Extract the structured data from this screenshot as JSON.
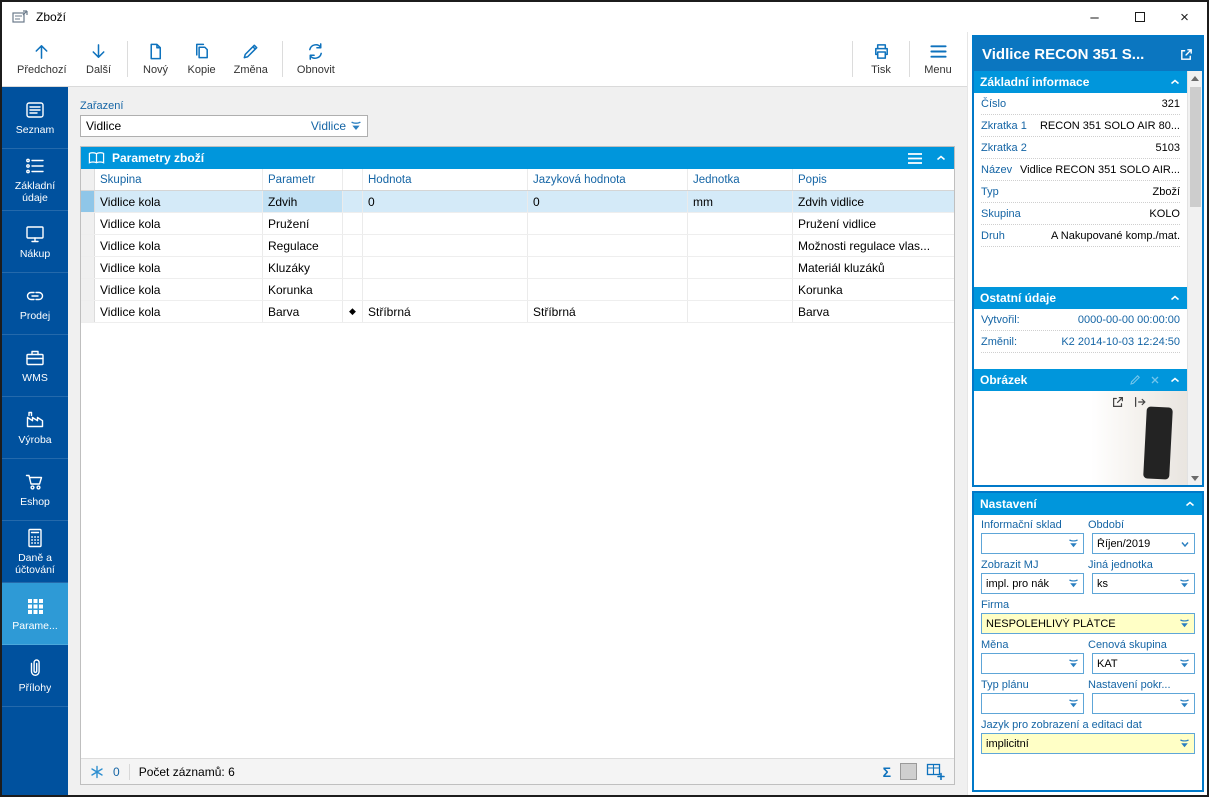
{
  "window": {
    "title": "Zboží",
    "controls": {
      "minimize": "–",
      "close": "×"
    }
  },
  "colors": {
    "accent": "#0096dc",
    "sidebar": "#00519e",
    "sidebar_active": "#2e9ad6",
    "panel_border": "#0079c8",
    "selection": "#d4eaf8",
    "warning_field": "#ffffc6",
    "label_blue": "#1565a5"
  },
  "toolbar": {
    "predchozi": "Předchozí",
    "dalsi": "Další",
    "novy": "Nový",
    "kopie": "Kopie",
    "zmena": "Změna",
    "obnovit": "Obnovit",
    "tisk": "Tisk",
    "menu": "Menu"
  },
  "sidebar": {
    "items": [
      {
        "label": "Seznam"
      },
      {
        "label": "Základní údaje"
      },
      {
        "label": "Nákup"
      },
      {
        "label": "Prodej"
      },
      {
        "label": "WMS"
      },
      {
        "label": "Výroba"
      },
      {
        "label": "Eshop"
      },
      {
        "label": "Daně a účtování"
      },
      {
        "label": "Parame...",
        "active": true
      },
      {
        "label": "Přílohy"
      }
    ]
  },
  "main": {
    "zarazeni": {
      "label": "Zařazení",
      "value": "Vidlice",
      "link": "Vidlice"
    },
    "params": {
      "title": "Parametry zboží",
      "columns": {
        "skupina": "Skupina",
        "parametr": "Parametr",
        "hodnota": "Hodnota",
        "jazykova": "Jazyková hodnota",
        "jednotka": "Jednotka",
        "popis": "Popis"
      },
      "rows": [
        {
          "skupina": "Vidlice kola",
          "parametr": "Zdvih",
          "marker": "",
          "hodnota": "0",
          "jazykova": "0",
          "jednotka": "mm",
          "popis": "Zdvih vidlice",
          "selected": true
        },
        {
          "skupina": "Vidlice kola",
          "parametr": "Pružení",
          "marker": "",
          "hodnota": "",
          "jazykova": "",
          "jednotka": "",
          "popis": "Pružení vidlice"
        },
        {
          "skupina": "Vidlice kola",
          "parametr": "Regulace",
          "marker": "",
          "hodnota": "",
          "jazykova": "",
          "jednotka": "",
          "popis": "Možnosti regulace vlas..."
        },
        {
          "skupina": "Vidlice kola",
          "parametr": "Kluzáky",
          "marker": "",
          "hodnota": "",
          "jazykova": "",
          "jednotka": "",
          "popis": "Materiál kluzáků"
        },
        {
          "skupina": "Vidlice kola",
          "parametr": "Korunka",
          "marker": "",
          "hodnota": "",
          "jazykova": "",
          "jednotka": "",
          "popis": "Korunka"
        },
        {
          "skupina": "Vidlice kola",
          "parametr": "Barva",
          "marker": "◆",
          "hodnota": "Stříbrná",
          "jazykova": "Stříbrná",
          "jednotka": "",
          "popis": "Barva"
        }
      ]
    },
    "status": {
      "flag_count": "0",
      "records": "Počet záznamů: 6",
      "sigma": "Σ"
    }
  },
  "right": {
    "title": "Vidlice RECON 351 S...",
    "zakladni": {
      "title": "Základní informace",
      "fields": [
        {
          "label": "Číslo",
          "value": "321"
        },
        {
          "label": "Zkratka 1",
          "value": "RECON 351 SOLO AIR 80..."
        },
        {
          "label": "Zkratka 2",
          "value": "5103"
        },
        {
          "label": "Název",
          "value": "Vidlice RECON 351 SOLO AIR..."
        },
        {
          "label": "Typ",
          "value": "Zboží"
        },
        {
          "label": "Skupina",
          "value": "KOLO"
        },
        {
          "label": "Druh",
          "value": "A Nakupované komp./mat."
        }
      ]
    },
    "ostatni": {
      "title": "Ostatní údaje",
      "fields": [
        {
          "label": "Vytvořil:",
          "value": "0000-00-00 00:00:00"
        },
        {
          "label": "Změnil:",
          "value": "K2 2014-10-03 12:24:50"
        }
      ]
    },
    "obrazek": {
      "title": "Obrázek"
    },
    "nastaveni": {
      "title": "Nastavení",
      "informacni_sklad": {
        "label": "Informační sklad",
        "value": ""
      },
      "obdobi": {
        "label": "Období",
        "value": "Říjen/2019"
      },
      "zobrazit_mj": {
        "label": "Zobrazit MJ",
        "value": "impl. pro nák"
      },
      "jina_jednotka": {
        "label": "Jiná jednotka",
        "value": "ks"
      },
      "firma": {
        "label": "Firma",
        "value": "NESPOLEHLIVÝ PLÁTCE"
      },
      "mena": {
        "label": "Měna",
        "value": ""
      },
      "cenova_skupina": {
        "label": "Cenová skupina",
        "value": "KAT"
      },
      "typ_planu": {
        "label": "Typ plánu",
        "value": ""
      },
      "nastaveni_pokr": {
        "label": "Nastavení pokr...",
        "value": ""
      },
      "jazyk": {
        "label": "Jazyk pro zobrazení a editaci dat",
        "value": "implicitní"
      }
    }
  }
}
